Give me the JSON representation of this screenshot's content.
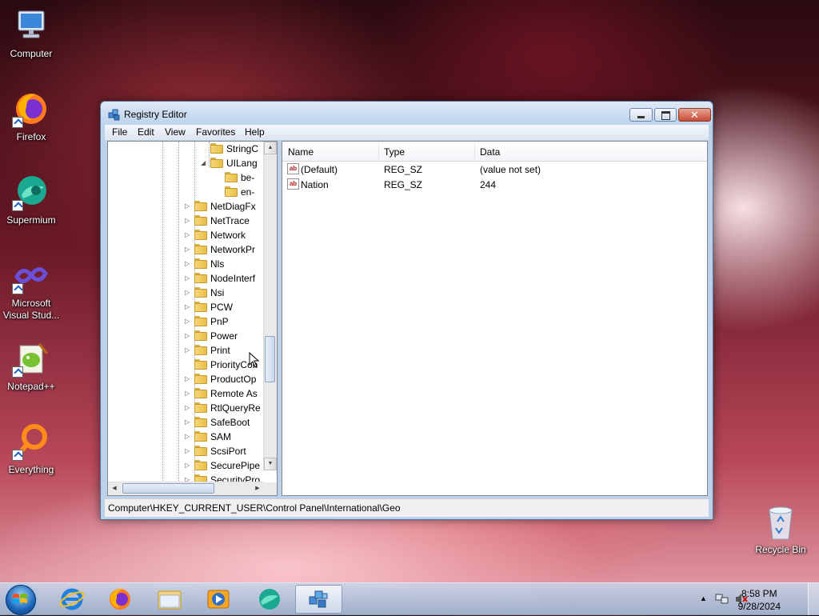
{
  "desktop": {
    "icons": [
      {
        "label": "Computer"
      },
      {
        "label": "Firefox"
      },
      {
        "label": "Supermium"
      },
      {
        "label": "Microsoft Visual Stud..."
      },
      {
        "label": "Notepad++"
      },
      {
        "label": "Everything"
      }
    ],
    "recycle_bin": {
      "label": "Recycle Bin"
    }
  },
  "window": {
    "title": "Registry Editor",
    "icon": "registry-editor-icon",
    "menu": [
      "File",
      "Edit",
      "View",
      "Favorites",
      "Help"
    ],
    "tree": {
      "nodes": [
        {
          "label": "StringC",
          "expander": "",
          "level": 3
        },
        {
          "label": "UILang",
          "expander": "◢",
          "level": 3
        },
        {
          "label": "be-",
          "expander": "",
          "level": 4
        },
        {
          "label": "en-",
          "expander": "",
          "level": 4
        },
        {
          "label": "NetDiagFx",
          "expander": "▷",
          "level": 2
        },
        {
          "label": "NetTrace",
          "expander": "▷",
          "level": 2
        },
        {
          "label": "Network",
          "expander": "▷",
          "level": 2
        },
        {
          "label": "NetworkPr",
          "expander": "▷",
          "level": 2
        },
        {
          "label": "Nls",
          "expander": "▷",
          "level": 2
        },
        {
          "label": "NodeInterf",
          "expander": "▷",
          "level": 2
        },
        {
          "label": "Nsi",
          "expander": "▷",
          "level": 2
        },
        {
          "label": "PCW",
          "expander": "▷",
          "level": 2
        },
        {
          "label": "PnP",
          "expander": "▷",
          "level": 2
        },
        {
          "label": "Power",
          "expander": "▷",
          "level": 2
        },
        {
          "label": "Print",
          "expander": "▷",
          "level": 2
        },
        {
          "label": "PriorityCon",
          "expander": "",
          "level": 2
        },
        {
          "label": "ProductOp",
          "expander": "▷",
          "level": 2
        },
        {
          "label": "Remote As",
          "expander": "▷",
          "level": 2
        },
        {
          "label": "RtlQueryRe",
          "expander": "▷",
          "level": 2
        },
        {
          "label": "SafeBoot",
          "expander": "▷",
          "level": 2
        },
        {
          "label": "SAM",
          "expander": "▷",
          "level": 2
        },
        {
          "label": "ScsiPort",
          "expander": "▷",
          "level": 2
        },
        {
          "label": "SecurePipe",
          "expander": "▷",
          "level": 2
        },
        {
          "label": "SecurityPro",
          "expander": "▷",
          "level": 2
        }
      ]
    },
    "list": {
      "columns": [
        "Name",
        "Type",
        "Data"
      ],
      "rows": [
        {
          "name": "(Default)",
          "type": "REG_SZ",
          "data": "(value not set)"
        },
        {
          "name": "Nation",
          "type": "REG_SZ",
          "data": "244"
        }
      ]
    },
    "status": "Computer\\HKEY_CURRENT_USER\\Control Panel\\International\\Geo"
  },
  "taskbar": {
    "buttons": [
      {
        "name": "internet-explorer"
      },
      {
        "name": "firefox"
      },
      {
        "name": "file-explorer"
      },
      {
        "name": "media-player"
      },
      {
        "name": "supermium"
      },
      {
        "name": "registry-editor",
        "active": true
      }
    ],
    "clock": {
      "time": "8:58 PM",
      "date": "9/28/2024"
    }
  }
}
